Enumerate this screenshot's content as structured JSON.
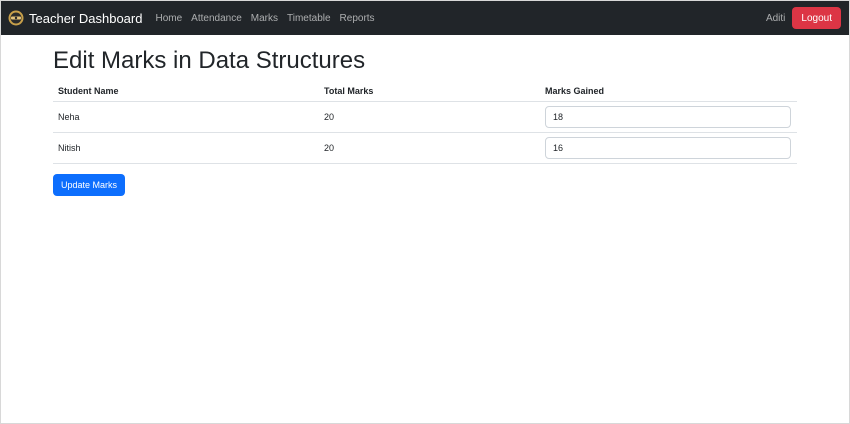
{
  "navbar": {
    "brand_text": "Teacher Dashboard",
    "brand_icon": "teacher-badge-icon",
    "links": [
      "Home",
      "Attendance",
      "Marks",
      "Timetable",
      "Reports"
    ],
    "user_name": "Aditi",
    "logout_label": "Logout"
  },
  "page": {
    "title": "Edit Marks in Data Structures"
  },
  "table": {
    "headers": [
      "Student Name",
      "Total Marks",
      "Marks Gained"
    ],
    "rows": [
      {
        "name": "Neha",
        "total": "20",
        "gained": "18"
      },
      {
        "name": "Nitish",
        "total": "20",
        "gained": "16"
      }
    ]
  },
  "form": {
    "submit_label": "Update Marks"
  },
  "colors": {
    "navbar_bg": "#212529",
    "logout_bg": "#dc3545",
    "primary_btn": "#0d6efd"
  }
}
